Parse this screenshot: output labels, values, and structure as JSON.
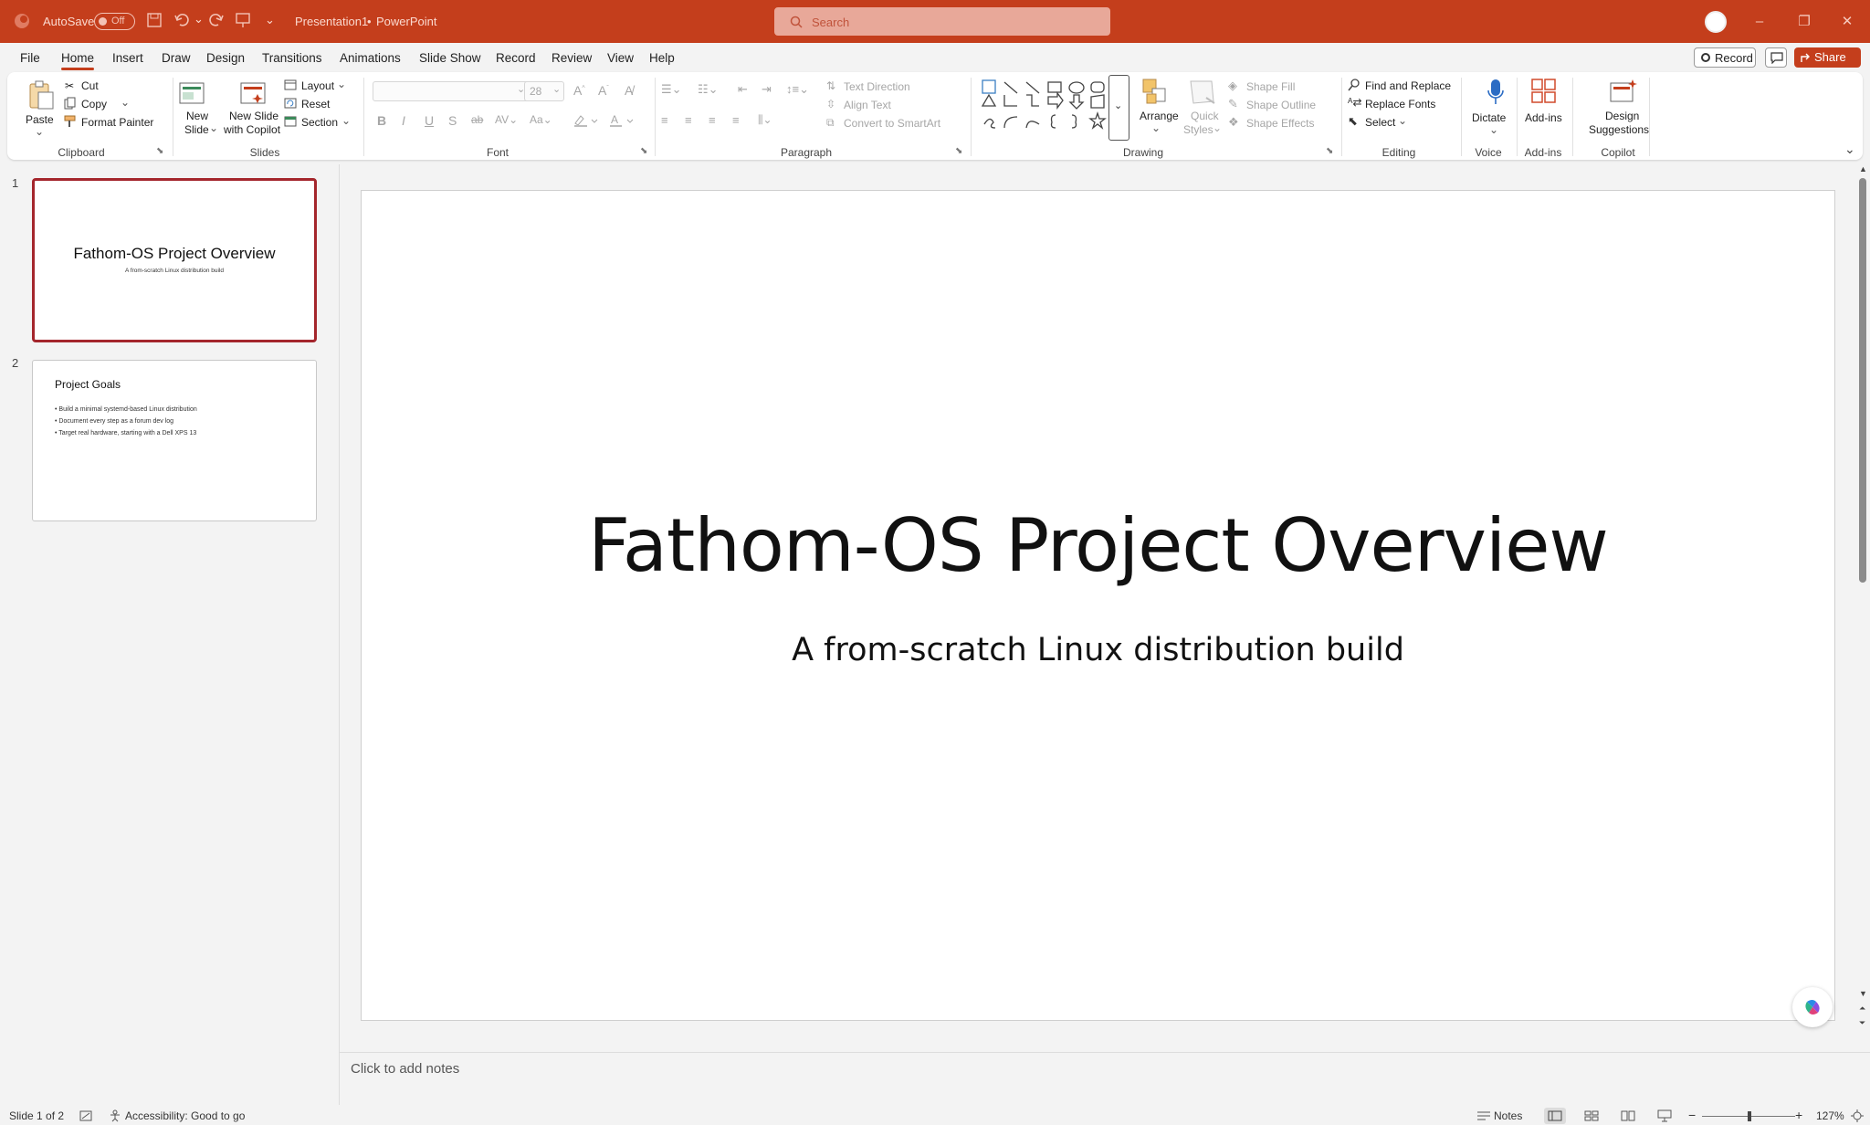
{
  "titlebar": {
    "autosave_label": "AutoSave",
    "autosave_state": "Off",
    "doc_title": "Presentation1",
    "separator": "•",
    "app_name": "PowerPoint",
    "search_placeholder": "Search"
  },
  "menu": {
    "tabs": [
      "File",
      "Home",
      "Insert",
      "Draw",
      "Design",
      "Transitions",
      "Animations",
      "Slide Show",
      "Record",
      "Review",
      "View",
      "Help"
    ],
    "active_tab": "Home",
    "record_label": "Record",
    "share_label": "Share"
  },
  "ribbon": {
    "clipboard": {
      "paste": "Paste",
      "cut": "Cut",
      "copy": "Copy",
      "format_painter": "Format Painter",
      "group": "Clipboard"
    },
    "slides": {
      "new_slide_1": "New",
      "new_slide_2": "Slide",
      "copilot_1": "New Slide",
      "copilot_2": "with Copilot",
      "layout": "Layout",
      "reset": "Reset",
      "section": "Section",
      "group": "Slides"
    },
    "font": {
      "size": "28",
      "group": "Font"
    },
    "paragraph": {
      "text_direction": "Text Direction",
      "align_text": "Align Text",
      "convert_smartart": "Convert to SmartArt",
      "group": "Paragraph"
    },
    "drawing": {
      "arrange": "Arrange",
      "quick_1": "Quick",
      "quick_2": "Styles",
      "shape_fill": "Shape Fill",
      "shape_outline": "Shape Outline",
      "shape_effects": "Shape Effects",
      "group": "Drawing"
    },
    "editing": {
      "find_replace": "Find and Replace",
      "replace_fonts": "Replace Fonts",
      "select": "Select",
      "group": "Editing"
    },
    "voice": {
      "dictate": "Dictate",
      "group": "Voice"
    },
    "addins": {
      "addins": "Add-ins",
      "group": "Add-ins"
    },
    "copilot": {
      "design_1": "Design",
      "design_2": "Suggestions",
      "group": "Copilot"
    }
  },
  "thumbnails": [
    {
      "num": "1",
      "title": "Fathom-OS Project Overview",
      "subtitle": "A from-scratch Linux distribution build"
    },
    {
      "num": "2",
      "title": "Project Goals",
      "bullets": [
        "• Build a minimal systemd-based Linux distribution",
        "• Document every step as a forum dev log",
        "• Target real hardware, starting with a Dell XPS 13"
      ]
    }
  ],
  "slide": {
    "title": "Fathom-OS Project Overview",
    "subtitle": "A from-scratch Linux distribution build"
  },
  "notes": {
    "placeholder": "Click to add notes"
  },
  "status": {
    "slide_info": "Slide 1 of 2",
    "accessibility": "Accessibility: Good to go",
    "notes_label": "Notes",
    "zoom": "127%",
    "minus": "−",
    "plus": "+"
  },
  "colors": {
    "brand": "#c43e1c",
    "selected_thumb": "#a4262c"
  }
}
